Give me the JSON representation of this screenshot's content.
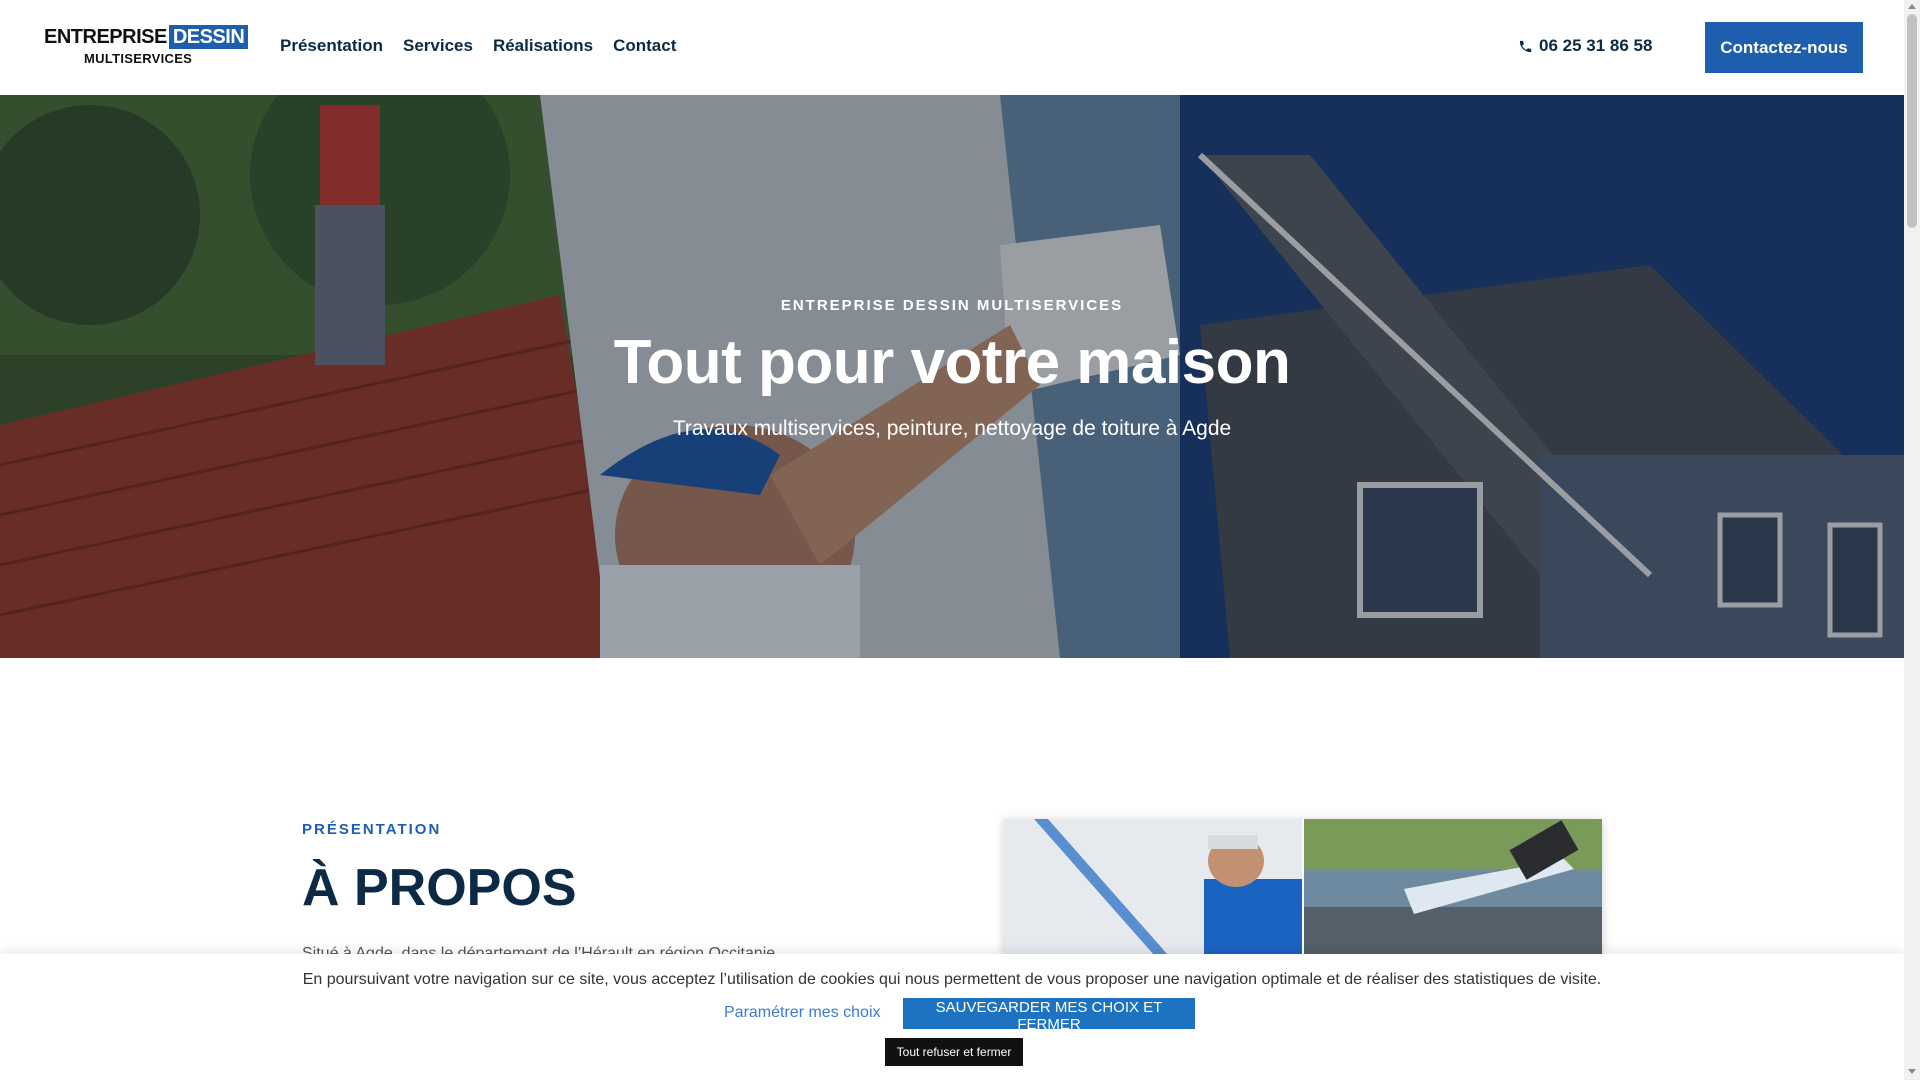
{
  "header": {
    "logo": {
      "line1": "ENTREPRISE",
      "line1_boxed": "DESSIN",
      "line2": "MULTISERVICES"
    },
    "nav": [
      "Présentation",
      "Services",
      "Réalisations",
      "Contact"
    ],
    "phone": "06 25 31 86 58",
    "cta": "Contactez-nous"
  },
  "hero": {
    "kicker": "ENTREPRISE DESSIN MULTISERVICES",
    "title": "Tout pour votre maison",
    "subtitle": "Travaux multiservices, peinture, nettoyage de toiture à Agde"
  },
  "about": {
    "kicker": "PRÉSENTATION",
    "title": "À PROPOS",
    "text": "Situé à Agde, dans le département de l’Hérault en région Occitanie,"
  },
  "cookie": {
    "message": "En poursuivant votre navigation sur ce site, vous acceptez l’utilisation de cookies qui nous permettent de vous proposer une navigation optimale et de réaliser des statistiques de visite.",
    "settings": "Paramétrer mes choix",
    "save": "SAUVEGARDER MES CHOIX ET FERMER",
    "refuse": "Tout refuser et fermer"
  },
  "colors": {
    "brand": "#1d5fae",
    "navy": "#0d2a44",
    "cookie_button": "#1d72c2"
  },
  "icons": {
    "phone": "phone-icon"
  }
}
